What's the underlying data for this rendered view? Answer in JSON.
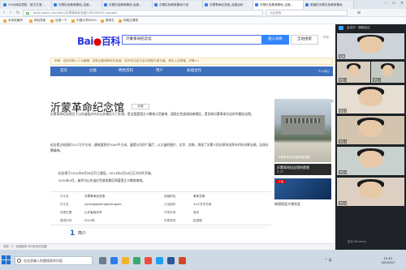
{
  "browser": {
    "tabs": [
      {
        "label": "2345网址导航 - 致力打造..."
      },
      {
        "label": "沂蒙红色教育基地_百度..."
      },
      {
        "label": "沂蒙红色教育基地 百度..."
      },
      {
        "label": "沂蒙红色教育基地介绍"
      },
      {
        "label": "沂蒙革命纪念馆_百度百科"
      },
      {
        "label": "沂蒙红色教育基地_百度..."
      },
      {
        "label": "美丽的沂蒙红色教育基地"
      }
    ],
    "url": "baike.baidu.com/item/沂蒙革命纪念馆/1583994?fr=aladdin",
    "ext_search_placeholder": "点此搜索",
    "favorites": [
      {
        "label": "手机收藏夹"
      },
      {
        "label": "网址导航"
      },
      {
        "label": "百度一下"
      },
      {
        "label": "中国大学MOOC"
      },
      {
        "label": "爱奇艺"
      },
      {
        "label": "网易云课堂"
      }
    ]
  },
  "baike": {
    "logo_bai": "Bai",
    "logo_du": "百科",
    "search_value": "沂蒙革命纪念馆",
    "enter_label": "进入词条",
    "all_label": "全站搜索",
    "help_label": "帮助",
    "notice": "声明：百科词条人人可编辑，词条创建和修改均免费，绝不存在官方及代理商付费代编，请勿上当受骗。详情>>",
    "nav": [
      "首页",
      "分类",
      "特色百科",
      "用户",
      "权威合作",
      "个人中心"
    ],
    "title": "沂蒙革命纪念馆",
    "collect_label": "收藏",
    "top_right": "49  |  分享",
    "paragraphs": [
      "沂蒙革命纪念馆位于山东省临沂市沂山风景区大门北侧，是全国爱国主义教育示范基地、国家红色旅游经典景区，是反映沂蒙革命历史的专题纪念馆。",
      "纪念馆占地面积3.47万平方米，建筑面积约7000平方米，展馆分为四个展厅，以大量的图片、文字、实物，再现了沂蒙人民在革命战争年代的光辉业绩，弘扬沂蒙精神。",
      "纪念馆于2012年6月28日开工建设，2014年4月26日正式对外开放。",
      "2020年4月，被评为山东省红色旅游景区和爱国主义教育基地。"
    ],
    "info": [
      {
        "l1": "中文名",
        "v1": "沂蒙革命纪念馆",
        "l2": "馆藏精品",
        "v2": "革命文物"
      },
      {
        "l1": "外文名",
        "v1": "yimenggemingjinianguan",
        "l2": "占地面积",
        "v2": "3.47万平方米"
      },
      {
        "l1": "地理位置",
        "v1": "山东省临沂市",
        "l2": "开放时间",
        "v2": "全天"
      },
      {
        "l1": "建成时间",
        "v1": "2014年",
        "l2": "所属类别",
        "v2": "纪念馆"
      }
    ],
    "intro_num": "1",
    "intro_label": "简介",
    "photo_caption": "沂蒙革命纪念馆的概况图",
    "plays_title": "沂蒙革命纪念馆的视频",
    "plays_time": "0:37",
    "ad_badge": "广告",
    "ad_text": "南国家居大博览会"
  },
  "status": {
    "text": "完成 · 0 · 欢迎使用 360安全浏览器"
  },
  "meeting": {
    "title": "会议中 · 视频会议",
    "participants": [
      {
        "name": "老师"
      },
      {
        "name": "学生1"
      },
      {
        "name": "学生2"
      },
      {
        "name": "学生3"
      },
      {
        "name": "学生4"
      },
      {
        "name": "学生5"
      },
      {
        "name": "学生6"
      }
    ],
    "activate": "激活 Windows"
  },
  "taskbar": {
    "search_placeholder": "在这里输入你要搜索的内容",
    "time": "10:01",
    "date": "2020/4/7",
    "tray": "^ 英"
  }
}
